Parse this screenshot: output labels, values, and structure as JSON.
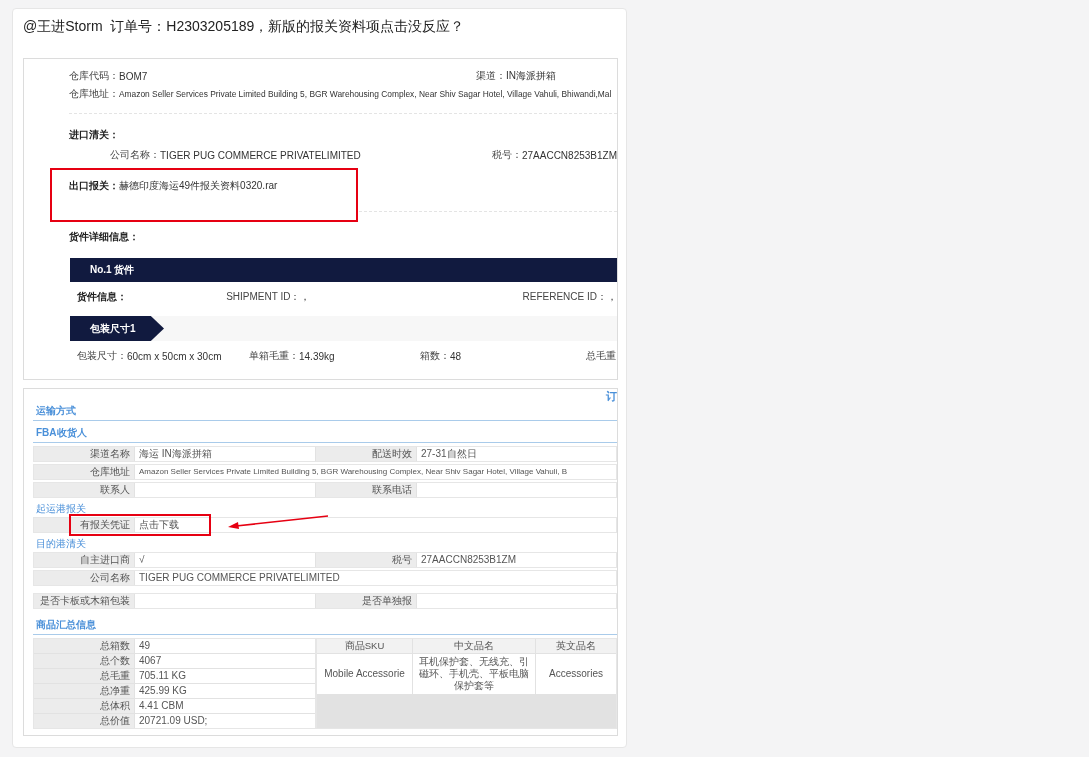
{
  "message": {
    "text": "@王进Storm  订单号：H2303205189，新版的报关资料项点击没反应？"
  },
  "screenshot_1": {
    "warehouse_code": {
      "label": "仓库代码：",
      "value": "BOM7"
    },
    "channel": {
      "label": "渠道：",
      "value": "IN海派拼箱"
    },
    "warehouse_address": {
      "label": "仓库地址：",
      "value": "Amazon Seller Services Private Limited Building 5, BGR Warehousing Complex, Near Shiv Sagar Hotel, Village Vahuli, Bhiwandi,Mal"
    },
    "import_clearance": {
      "title": "进口清关：",
      "company": {
        "label": "公司名称：",
        "value": "TIGER PUG COMMERCE PRIVATELIMITED"
      },
      "tax_id": {
        "label": "税号：",
        "value": "27AACCN8253B1ZM"
      }
    },
    "export_declaration": {
      "label": "出口报关：",
      "file": "赫德印度海运49件报关资料0320.rar",
      "annotated": true
    },
    "cargo_title": "货件详细信息：",
    "shipment": {
      "header": "No.1 货件",
      "info_label": "货件信息：",
      "fields": [
        {
          "label": "SHIPMENT ID：",
          "value": "，"
        },
        {
          "label": "REFERENCE ID：",
          "value": "，"
        }
      ],
      "package_tab": "包装尺寸1",
      "package_fields": [
        {
          "label": "包装尺寸：",
          "value": "60cm x 50cm x 30cm"
        },
        {
          "label": "单箱毛重：",
          "value": "14.39kg"
        },
        {
          "label": "箱数：",
          "value": "48"
        },
        {
          "label": "总毛重"
        }
      ]
    }
  },
  "screenshot_2": {
    "corner_text": "订",
    "sections": [
      {
        "kind": "major",
        "title": "运输方式"
      },
      {
        "kind": "major",
        "title": "FBA收货人",
        "rows": [
          [
            {
              "label": "渠道名称",
              "value": "海运 IN海派拼箱"
            },
            {
              "label": "配送时效",
              "value": "27-31自然日"
            }
          ],
          [
            {
              "label": "仓库地址",
              "value": "Amazon Seller Services Private Limited Building 5, BGR Warehousing Complex, Near Shiv Sagar Hotel, Village Vahuli, B"
            }
          ],
          [
            {
              "label": "联系人"
            },
            {
              "label": "联系电话"
            }
          ]
        ]
      },
      {
        "kind": "minor",
        "title": "起运港报关",
        "rows": [
          [
            {
              "label": "有报关凭证",
              "value": "点击下载",
              "annotated": true
            }
          ]
        ]
      },
      {
        "kind": "minor",
        "title": "目的港清关",
        "rows": [
          [
            {
              "label": "自主进口商",
              "value": "√"
            },
            {
              "label": "税号",
              "value": "27AACCN8253B1ZM"
            }
          ],
          [
            {
              "label": "公司名称",
              "value": "TIGER PUG COMMERCE PRIVATELIMITED"
            }
          ]
        ]
      },
      {
        "kind": "plain",
        "rows": [
          [
            {
              "label": "是否卡板或木箱包装"
            },
            {
              "label": "是否单独报"
            }
          ]
        ]
      },
      {
        "kind": "major",
        "title": "商品汇总信息",
        "summary": {
          "rows": [
            {
              "label": "总箱数",
              "value": "49"
            },
            {
              "label": "总个数",
              "value": "4067"
            },
            {
              "label": "总毛重",
              "value": "705.11 KG"
            },
            {
              "label": "总净重",
              "value": "425.99 KG"
            },
            {
              "label": "总体积",
              "value": "4.41 CBM"
            },
            {
              "label": "总价值",
              "value": "20721.09 USD;"
            }
          ],
          "columns": [
            "商品SKU",
            "中文品名",
            "英文品名"
          ],
          "items": [
            [
              "Mobile Accessorie",
              "耳机保护套、无线充、引磁环、手机壳、平板电脑保护套等",
              "Accessories"
            ]
          ]
        }
      }
    ]
  }
}
